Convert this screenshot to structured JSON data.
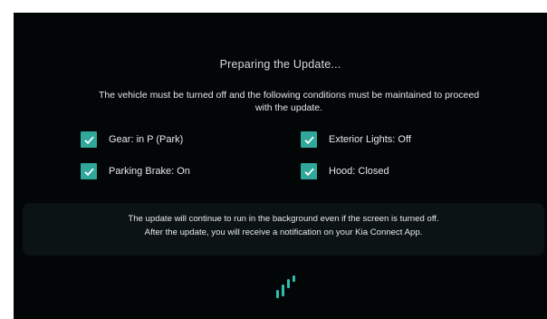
{
  "screen": {
    "title": "Preparing the Update...",
    "message_line1": "The vehicle must be turned off and the following conditions must be maintained to proceed",
    "message_line2": "with the update.",
    "conditions": [
      {
        "label": "Gear: in P (Park)",
        "checked": true
      },
      {
        "label": "Exterior Lights: Off",
        "checked": true
      },
      {
        "label": "Parking Brake: On",
        "checked": true
      },
      {
        "label": "Hood: Closed",
        "checked": true
      }
    ],
    "notice_line1": "The update will continue to run in the background even if the screen is turned off.",
    "notice_line2": "After the update, you will receive a notification on your Kia Connect App.",
    "loader_icon": "loading-bars-icon"
  },
  "colors": {
    "background": "#030607",
    "accent": "#2fa79a",
    "text": "#e6e9ec",
    "panel": "#0c1314"
  }
}
